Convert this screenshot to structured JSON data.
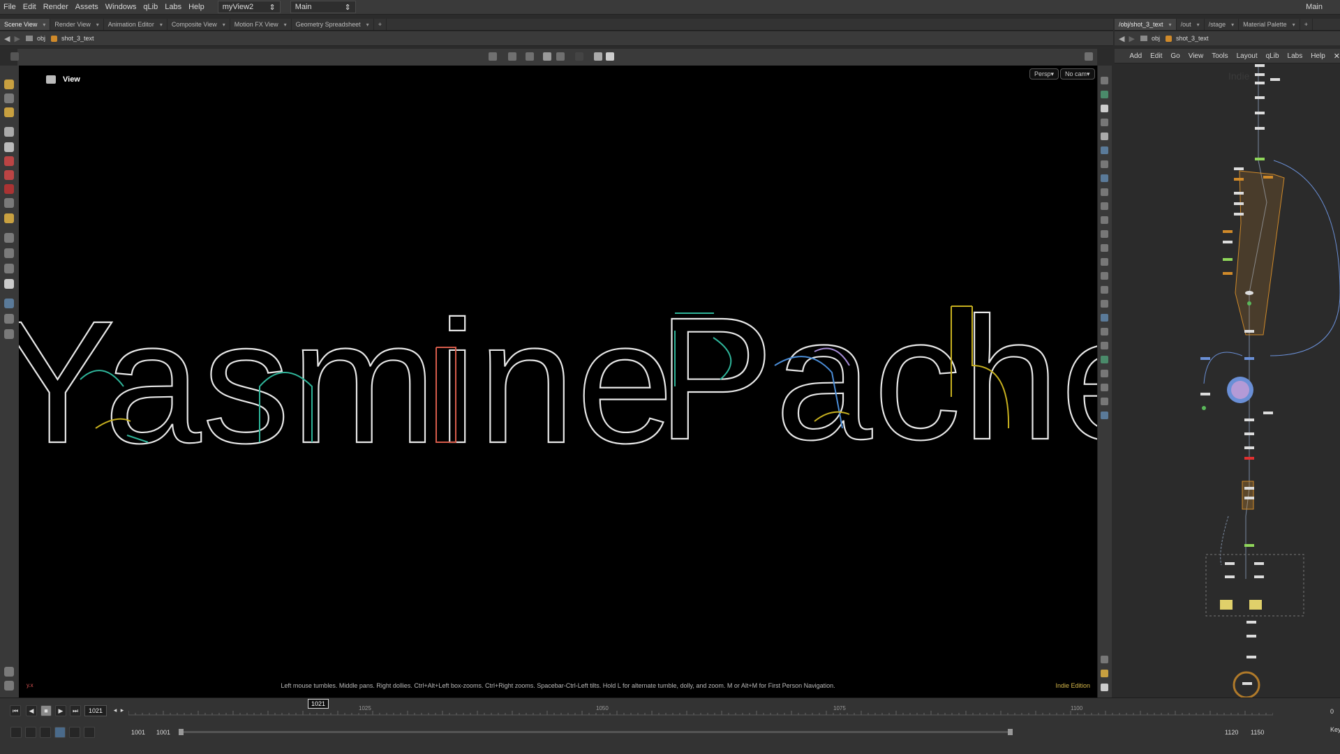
{
  "menubar": {
    "items": [
      "File",
      "Edit",
      "Render",
      "Assets",
      "Windows",
      "qLib",
      "Labs",
      "Help"
    ],
    "desktop": "myView2",
    "context": "Main",
    "right_label": "Main"
  },
  "tabs": [
    {
      "label": "Scene View"
    },
    {
      "label": "Render View"
    },
    {
      "label": "Animation Editor"
    },
    {
      "label": "Composite View"
    },
    {
      "label": "Motion FX View"
    },
    {
      "label": "Geometry Spreadsheet"
    }
  ],
  "path_left": {
    "root": "obj",
    "node": "shot_3_text"
  },
  "viewport": {
    "title": "View",
    "persp": "Persp",
    "cam": "No cam",
    "hint": "Left mouse tumbles. Middle pans. Right dollies. Ctrl+Alt+Left box-zooms. Ctrl+Right zooms. Spacebar-Ctrl-Left tilts. Hold L for alternate tumble, dolly, and zoom. M or Alt+M for First Person Navigation.",
    "edition": "Indie Edition",
    "axes": "y.x",
    "text_line1": "Yasmine",
    "text_line2": "Pache"
  },
  "net_tabs": [
    {
      "label": "/obj/shot_3_text"
    },
    {
      "label": "/out"
    },
    {
      "label": "/stage"
    },
    {
      "label": "Material Palette"
    }
  ],
  "net_path": {
    "root": "obj",
    "node": "shot_3_text"
  },
  "net_menu": [
    "Add",
    "Edit",
    "Go",
    "View",
    "Tools",
    "Layout",
    "qLib",
    "Labs",
    "Help"
  ],
  "net_watermark": "Indie",
  "timeline": {
    "current_frame": "1021",
    "start": "1001",
    "start2": "1001",
    "end": "1120",
    "end2": "1150",
    "marker": "1021",
    "ruler_labels": [
      "1025",
      "1050",
      "1075",
      "1100"
    ],
    "right_a": "0",
    "right_b": "Key"
  },
  "colors": {
    "accent": "#d6b84a",
    "node_orange": "#d08a2a",
    "node_blue": "#6a8fd6"
  }
}
